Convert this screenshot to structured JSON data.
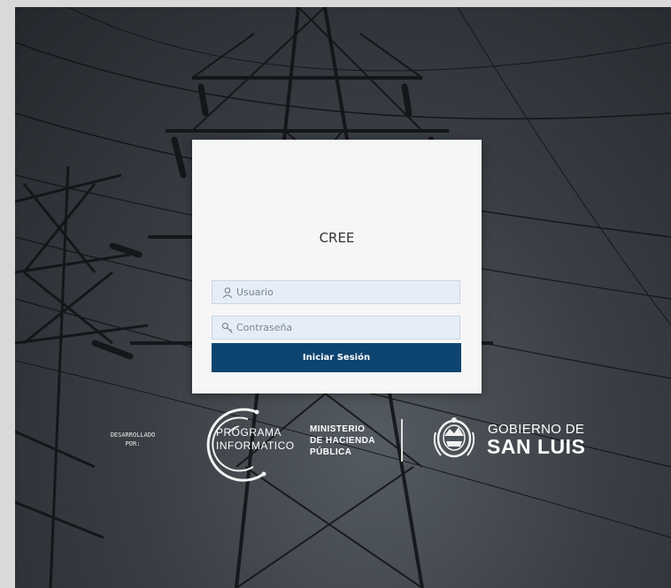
{
  "login": {
    "title": "CREE",
    "username_placeholder": "Usuario",
    "password_placeholder": "Contraseña",
    "submit_label": "Iniciar Sesión",
    "username_icon": "user-icon",
    "password_icon": "key-icon"
  },
  "footer": {
    "developed_by": "DESARROLLADO\nPOR:",
    "programa_line1": "PROGRAMA",
    "programa_line2": "INFORMATICO",
    "ministerio_line1": "MINISTERIO",
    "ministerio_line2": "DE HACIENDA",
    "ministerio_line3": "PÚBLICA",
    "gobierno_line1": "GOBIERNO DE",
    "gobierno_line2": "SAN LUIS"
  },
  "colors": {
    "button": "#0e4470",
    "field_bg": "#e5eef7",
    "card_bg": "#f6f6f6",
    "background": "#2f343a"
  }
}
